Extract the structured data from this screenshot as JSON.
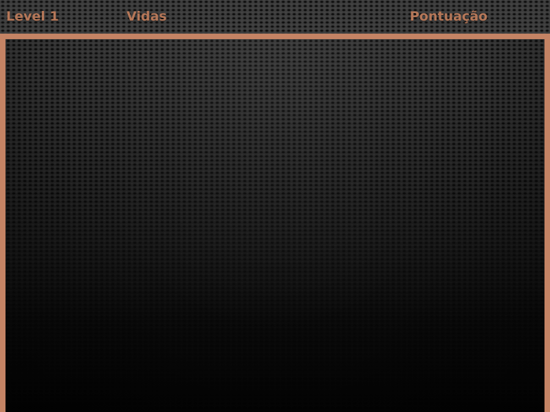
{
  "hud": {
    "level_label": "Level 1",
    "lives_label": "Vidas",
    "score_label": "Pontuação"
  },
  "colors": {
    "accent": "#c48364",
    "hud_text": "#b57758",
    "hud_background": "#3b3b3b",
    "playfield_top": "#343434",
    "playfield_bottom": "#030303"
  }
}
